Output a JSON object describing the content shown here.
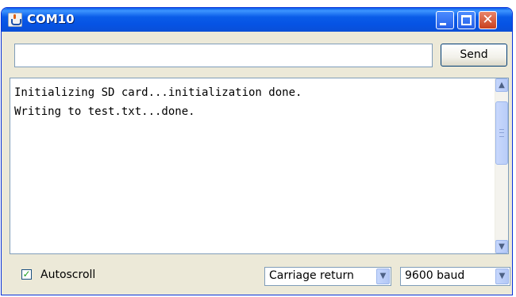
{
  "window": {
    "title": "COM10",
    "close_glyph": "✕"
  },
  "input": {
    "value": "",
    "placeholder": ""
  },
  "send": {
    "label": "Send"
  },
  "console": {
    "lines": [
      "Initializing SD card...initialization done.",
      "Writing to test.txt...done."
    ]
  },
  "scrollbar": {
    "up_glyph": "▲",
    "down_glyph": "▼"
  },
  "footer": {
    "autoscroll": {
      "label": "Autoscroll",
      "checked": true,
      "check_glyph": "✓"
    },
    "line_ending": {
      "value": "Carriage return"
    },
    "baud_rate": {
      "value": "9600 baud"
    },
    "dropdown_glyph": "▼"
  },
  "icons": {
    "app": "java-coffee-cup-icon",
    "minimize": "minimize-icon",
    "maximize": "maximize-icon",
    "close": "close-icon",
    "scroll_up": "scroll-up-arrow-icon",
    "scroll_down": "scroll-down-arrow-icon",
    "dropdown": "chevron-down-icon"
  },
  "colors": {
    "titlebar": "#0a5ce8",
    "window_bg": "#ece9d8",
    "close_button": "#c8401e",
    "checkmark": "#21a121"
  }
}
